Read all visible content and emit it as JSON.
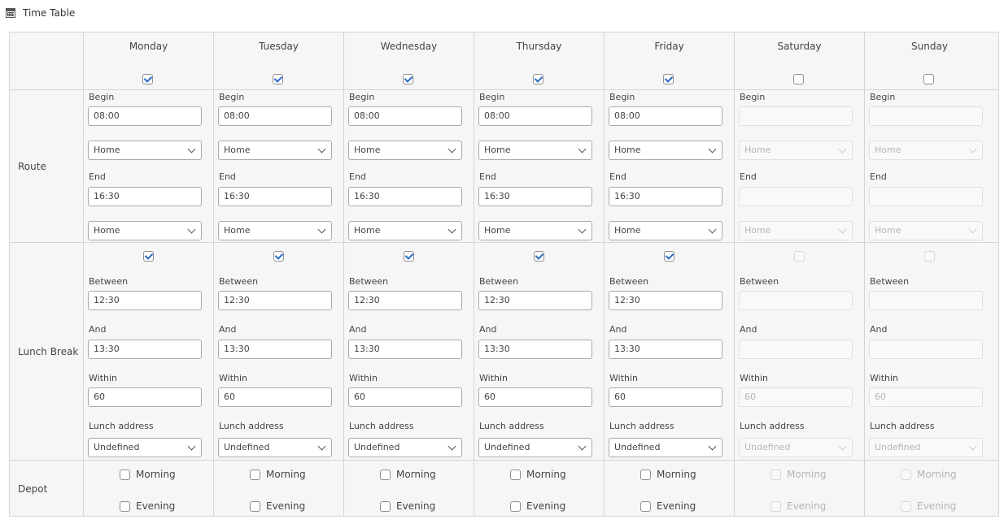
{
  "title": "Time Table",
  "icon": "calendar-icon",
  "rows": {
    "route": "Route",
    "lunch": "Lunch Break",
    "depot": "Depot"
  },
  "days": [
    {
      "name": "Monday",
      "enabled": true,
      "begin_label": "Begin",
      "begin": "08:00",
      "begin_addr": "Home",
      "end_label": "End",
      "end": "16:30",
      "end_addr": "Home",
      "lunch_enabled": true,
      "between_label": "Between",
      "between": "12:30",
      "and_label": "And",
      "and": "13:30",
      "within_label": "Within",
      "within": "60",
      "lunch_addr_label": "Lunch address",
      "lunch_addr": "Undefined",
      "morning_label": "Morning",
      "evening_label": "Evening"
    },
    {
      "name": "Tuesday",
      "enabled": true,
      "begin_label": "Begin",
      "begin": "08:00",
      "begin_addr": "Home",
      "end_label": "End",
      "end": "16:30",
      "end_addr": "Home",
      "lunch_enabled": true,
      "between_label": "Between",
      "between": "12:30",
      "and_label": "And",
      "and": "13:30",
      "within_label": "Within",
      "within": "60",
      "lunch_addr_label": "Lunch address",
      "lunch_addr": "Undefined",
      "morning_label": "Morning",
      "evening_label": "Evening"
    },
    {
      "name": "Wednesday",
      "enabled": true,
      "begin_label": "Begin",
      "begin": "08:00",
      "begin_addr": "Home",
      "end_label": "End",
      "end": "16:30",
      "end_addr": "Home",
      "lunch_enabled": true,
      "between_label": "Between",
      "between": "12:30",
      "and_label": "And",
      "and": "13:30",
      "within_label": "Within",
      "within": "60",
      "lunch_addr_label": "Lunch address",
      "lunch_addr": "Undefined",
      "morning_label": "Morning",
      "evening_label": "Evening"
    },
    {
      "name": "Thursday",
      "enabled": true,
      "begin_label": "Begin",
      "begin": "08:00",
      "begin_addr": "Home",
      "end_label": "End",
      "end": "16:30",
      "end_addr": "Home",
      "lunch_enabled": true,
      "between_label": "Between",
      "between": "12:30",
      "and_label": "And",
      "and": "13:30",
      "within_label": "Within",
      "within": "60",
      "lunch_addr_label": "Lunch address",
      "lunch_addr": "Undefined",
      "morning_label": "Morning",
      "evening_label": "Evening"
    },
    {
      "name": "Friday",
      "enabled": true,
      "begin_label": "Begin",
      "begin": "08:00",
      "begin_addr": "Home",
      "end_label": "End",
      "end": "16:30",
      "end_addr": "Home",
      "lunch_enabled": true,
      "between_label": "Between",
      "between": "12:30",
      "and_label": "And",
      "and": "13:30",
      "within_label": "Within",
      "within": "60",
      "lunch_addr_label": "Lunch address",
      "lunch_addr": "Undefined",
      "morning_label": "Morning",
      "evening_label": "Evening"
    },
    {
      "name": "Saturday",
      "enabled": false,
      "begin_label": "Begin",
      "begin": "",
      "begin_addr": "Home",
      "end_label": "End",
      "end": "",
      "end_addr": "Home",
      "lunch_enabled": false,
      "between_label": "Between",
      "between": "",
      "and_label": "And",
      "and": "",
      "within_label": "Within",
      "within": "60",
      "lunch_addr_label": "Lunch address",
      "lunch_addr": "Undefined",
      "morning_label": "Morning",
      "evening_label": "Evening"
    },
    {
      "name": "Sunday",
      "enabled": false,
      "begin_label": "Begin",
      "begin": "",
      "begin_addr": "Home",
      "end_label": "End",
      "end": "",
      "end_addr": "Home",
      "lunch_enabled": false,
      "between_label": "Between",
      "between": "",
      "and_label": "And",
      "and": "",
      "within_label": "Within",
      "within": "60",
      "lunch_addr_label": "Lunch address",
      "lunch_addr": "Undefined",
      "morning_label": "Morning",
      "evening_label": "Evening"
    }
  ]
}
